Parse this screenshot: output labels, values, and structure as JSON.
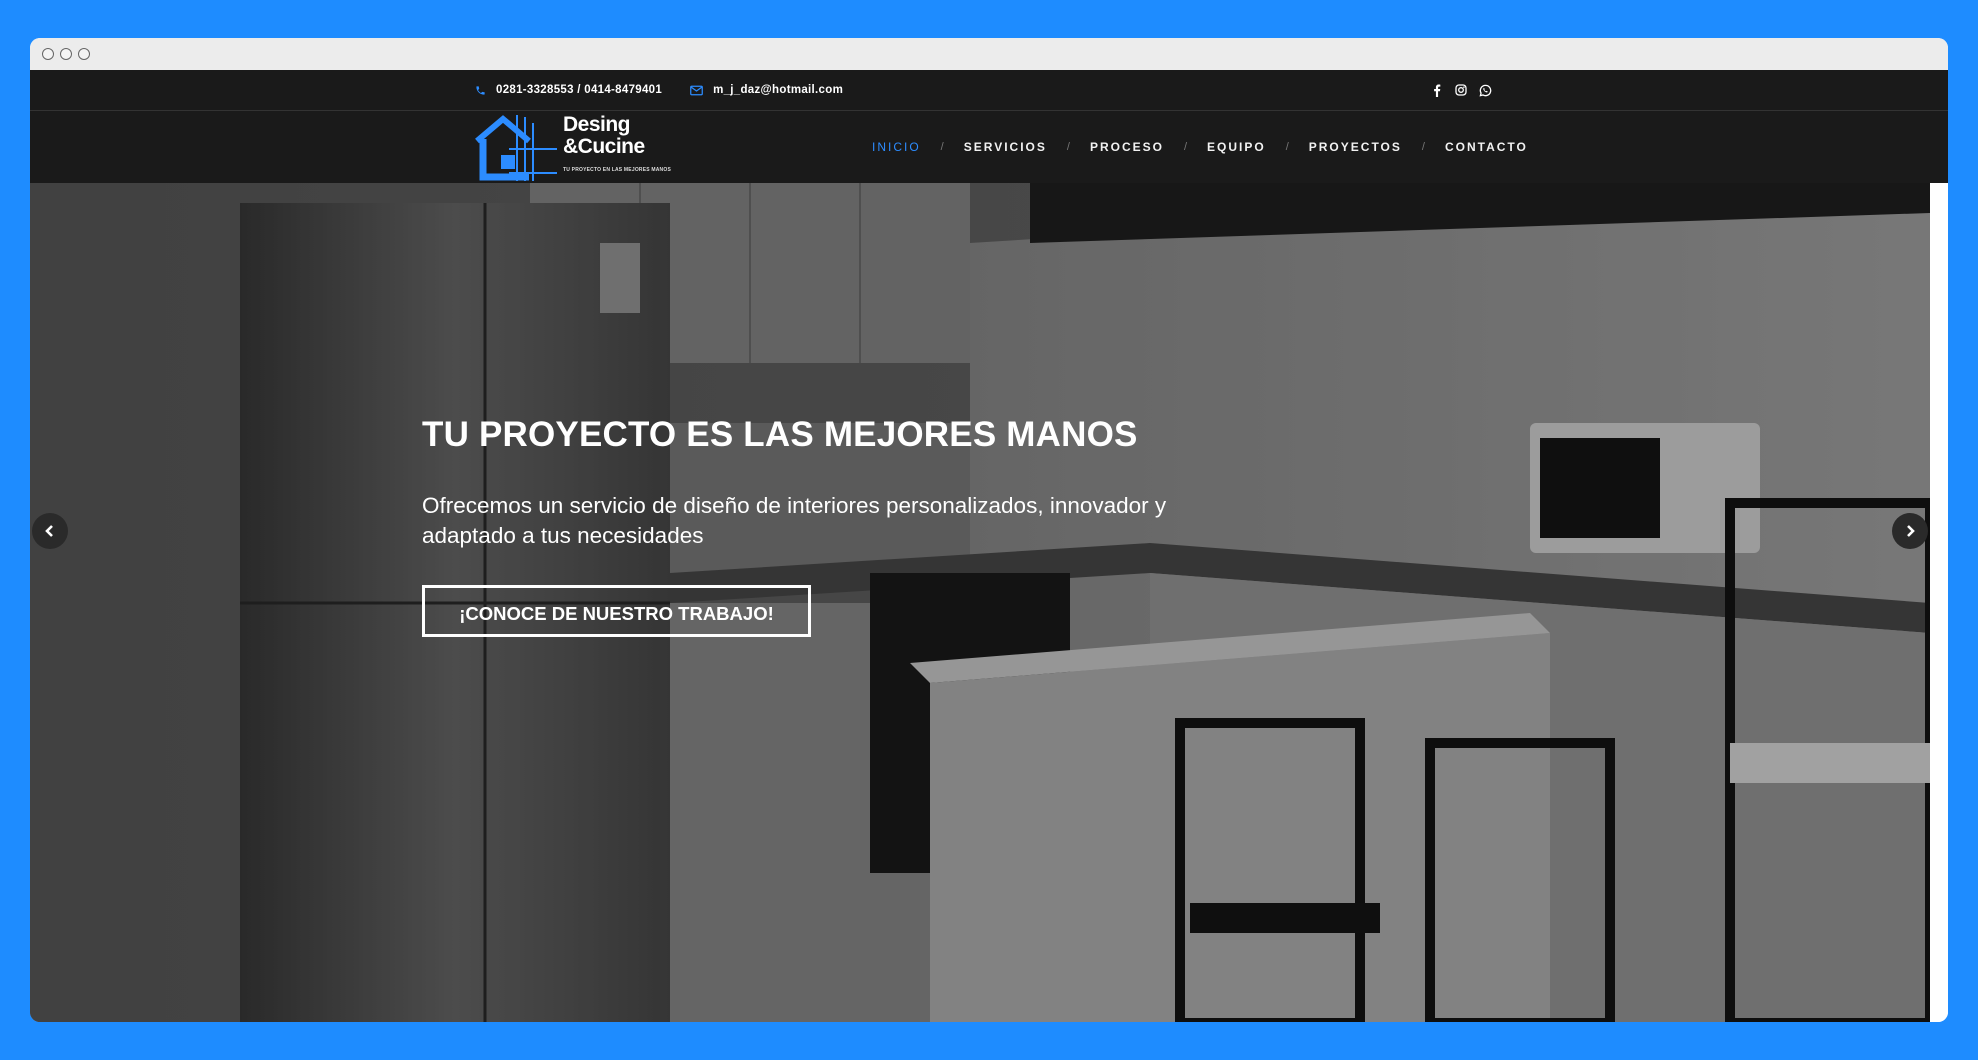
{
  "topbar": {
    "phone_icon": "phone-icon",
    "phone": "0281-3328553 / 0414-8479401",
    "email_icon": "envelope-icon",
    "email": "m_j_daz@hotmail.com",
    "social_icons": [
      "facebook-icon",
      "instagram-icon",
      "whatsapp-icon"
    ]
  },
  "logo": {
    "line1": "Desing",
    "line2": "&Cucine",
    "tagline": "TU PROYECTO EN LAS MEJORES MANOS"
  },
  "nav": {
    "items": [
      {
        "label": "INICIO",
        "active": true
      },
      {
        "label": "SERVICIOS",
        "active": false
      },
      {
        "label": "PROCESO",
        "active": false
      },
      {
        "label": "EQUIPO",
        "active": false
      },
      {
        "label": "PROYECTOS",
        "active": false
      },
      {
        "label": "CONTACTO",
        "active": false
      }
    ],
    "separator": "/"
  },
  "hero": {
    "title": "TU PROYECTO ES LAS MEJORES MANOS",
    "text": "Ofrecemos un servicio de diseño de interiores personalizados, innovador y adaptado a tus necesidades",
    "button": "¡CONOCE DE NUESTRO TRABAJO!",
    "prev_icon": "chevron-left-icon",
    "next_icon": "chevron-right-icon"
  },
  "colors": {
    "page_bg": "#1e8cff",
    "nav_bg": "#1a1a1a",
    "accent": "#2c8cff"
  }
}
